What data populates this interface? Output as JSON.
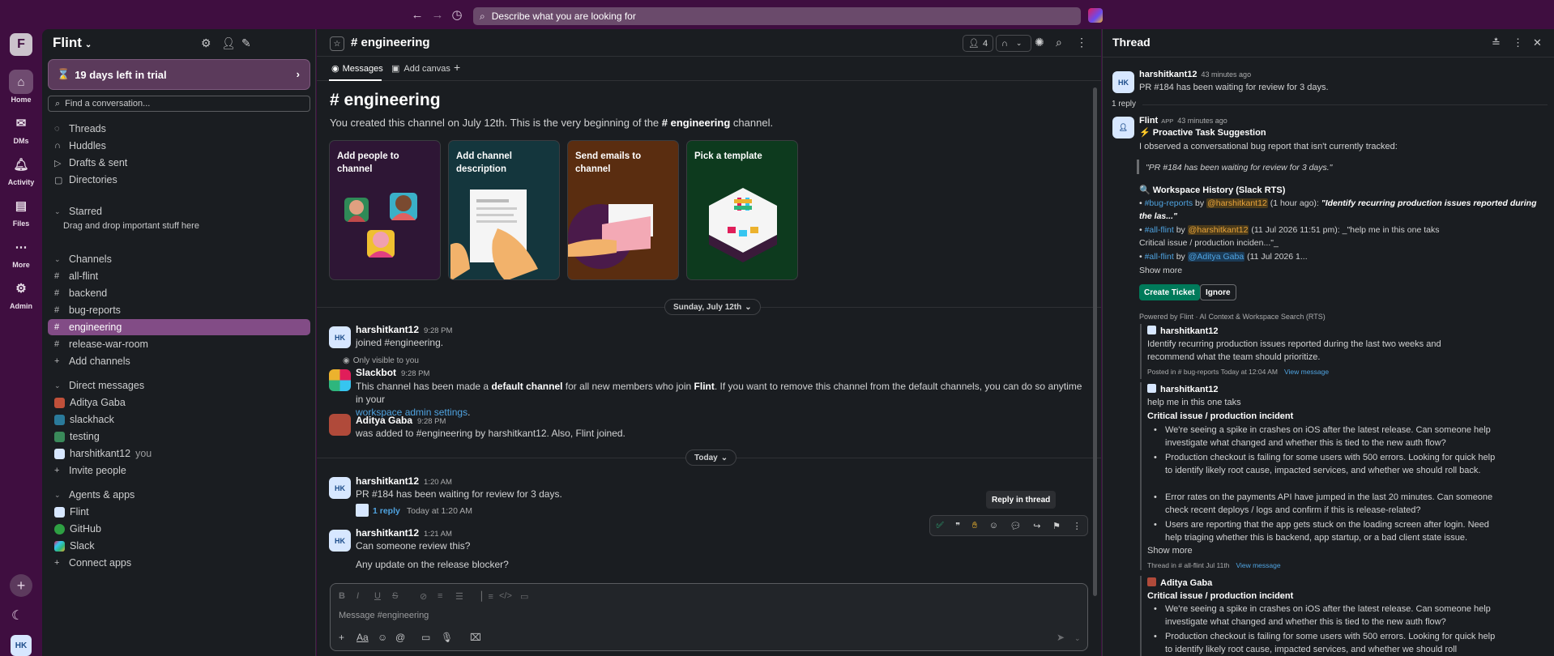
{
  "topbar": {
    "search_placeholder": "Describe what you are looking for"
  },
  "rail": {
    "workspace_initial": "F",
    "items": [
      "Home",
      "DMs",
      "Activity",
      "Files",
      "More",
      "Admin"
    ],
    "avatar": "HK"
  },
  "sidebar": {
    "workspace": "Flint",
    "trial": "19 days left in trial",
    "find_placeholder": "Find a conversation...",
    "nav": [
      "Threads",
      "Huddles",
      "Drafts & sent",
      "Directories"
    ],
    "starred_label": "Starred",
    "starred_hint": "Drag and drop important stuff here",
    "channels_label": "Channels",
    "channels": [
      "all-flint",
      "backend",
      "bug-reports",
      "engineering",
      "release-war-room"
    ],
    "add_channels": "Add channels",
    "dms_label": "Direct messages",
    "dms": [
      "Aditya Gaba",
      "slackhack",
      "testing",
      "harshitkant12"
    ],
    "you_label": "you",
    "invite": "Invite people",
    "apps_label": "Agents & apps",
    "apps": [
      "Flint",
      "GitHub",
      "Slack"
    ],
    "connect": "Connect apps"
  },
  "channel": {
    "name": "engineering",
    "members": "4",
    "tabs": [
      "Messages",
      "Add canvas"
    ],
    "intro_title": "engineering",
    "intro_pre": "You created this channel on July 12th. This is the very beginning of the ",
    "intro_bold": "# engineering",
    "intro_post": " channel.",
    "cards": [
      "Add people to channel",
      "Add channel description",
      "Send emails to channel",
      "Pick a template"
    ],
    "date1": "Sunday, July 12th",
    "date2": "Today",
    "composer_placeholder": "Message #engineering",
    "tooltip": "Reply in thread"
  },
  "messages": [
    {
      "author": "harshitkant12",
      "time": "9:28 PM",
      "text": "joined #engineering."
    },
    {
      "visibility": "Only visible to you",
      "author": "Slackbot",
      "time": "9:28 PM",
      "t1": "This channel has been made a ",
      "b1": "default channel",
      "t2": " for all new members who join ",
      "b2": "Flint",
      "t3": ". If you want to remove this channel from the default channels, you can do so anytime in your",
      "link": "workspace admin settings",
      "t4": "."
    },
    {
      "author": "Aditya Gaba",
      "time": "9:28 PM",
      "text": "was added to #engineering by harshitkant12. Also, Flint joined."
    },
    {
      "author": "harshitkant12",
      "time": "1:20 AM",
      "text": "PR #184 has been waiting for review for 3 days.",
      "reply_count": "1 reply",
      "reply_time": "Today at 1:20 AM"
    },
    {
      "author": "harshitkant12",
      "time": "1:21 AM",
      "text": "Can someone review this?",
      "text2": "Any update on the release blocker?"
    }
  ],
  "thread": {
    "title": "Thread",
    "parent_author": "harshitkant12",
    "parent_time": "43 minutes ago",
    "parent_text": "PR #184 has been waiting for review for 3 days.",
    "reply_count": "1 reply",
    "bot_name": "Flint",
    "app_tag": "APP",
    "bot_time": "43 minutes ago",
    "suggestion_title": "⚡ Proactive Task Suggestion",
    "observed": "I observed a conversational bug report that isn't currently tracked:",
    "quote": "\"PR #184 has been waiting for review for 3 days.\"",
    "history_title": "🔍 Workspace History (Slack RTS)",
    "h1_channel": "#bug-reports",
    "h1_by": " by ",
    "h1_user": "@harshitkant12",
    "h1_rest": " (1 hour ago): ",
    "h1_quote": "\"Identify recurring production issues reported during the las...\"",
    "h2_channel": "#all-flint",
    "h2_user": "@harshitkant12",
    "h2_rest": " (11 Jul 2026 11:51 pm): _\"help me in this one taks",
    "h2_line2": "Critical issue / production inciden...\"_",
    "h3_channel": "#all-flint",
    "h3_user": "@Aditya Gaba",
    "h3_rest": " (11 Jul 2026 1...",
    "show_more": "Show more",
    "btn_create": "Create Ticket",
    "btn_ignore": "Ignore",
    "powered": "Powered by Flint · AI Context & Workspace Search (RTS)",
    "q1_author": "harshitkant12",
    "q1_text": "Identify recurring production issues reported during the last two weeks and recommend what the team should prioritize.",
    "q1_meta": "Posted in # bug-reports  Today at 12:04 AM",
    "q1_link": "View message",
    "q2_author": "harshitkant12",
    "q2_line": "help me in this one taks",
    "q2_bold": "Critical issue / production incident",
    "q2_bullets": [
      "We're seeing a spike in crashes on iOS after the latest release. Can someone help investigate what changed and whether this is tied to the new auth flow?",
      "Production checkout is failing for some users with 500 errors. Looking for quick help to identify likely root cause, impacted services, and whether we should roll back.",
      "Error rates on the payments API have jumped in the last 20 minutes. Can someone check recent deploys / logs and confirm if this is release-related?",
      "Users are reporting that the app gets stuck on the loading screen after login. Need help triaging whether this is backend, app startup, or a bad client state issue."
    ],
    "q2_show_more": "Show more",
    "q2_meta": "Thread in # all-flint  Jul 11th",
    "q2_link": "View message",
    "q3_author": "Aditya Gaba",
    "q3_bold": "Critical issue / production incident",
    "q3_bullets": [
      "We're seeing a spike in crashes on iOS after the latest release. Can someone help investigate what changed and whether this is tied to the new auth flow?",
      "Production checkout is failing for some users with 500 errors. Looking for quick help to identify likely root cause, impacted services, and whether we should roll"
    ]
  }
}
